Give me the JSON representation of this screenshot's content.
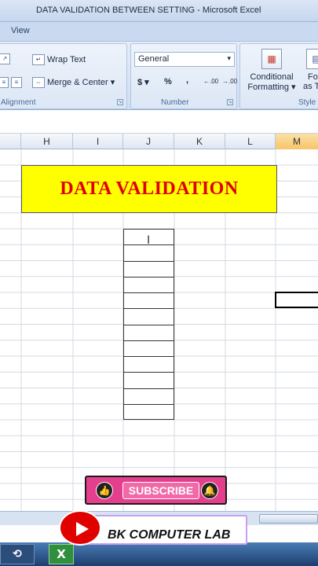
{
  "window": {
    "title": "DATA VALIDATION BETWEEN SETTING - Microsoft Excel"
  },
  "tabs": {
    "view": "View"
  },
  "ribbon": {
    "alignment": {
      "wrap_text": "Wrap Text",
      "merge_center": "Merge & Center",
      "label": "Alignment"
    },
    "number": {
      "format_value": "General",
      "currency": "$",
      "percent": "%",
      "comma": ",",
      "inc_decimal": ".00",
      "dec_decimal": ".00",
      "label": "Number"
    },
    "styles": {
      "conditional": "Conditional",
      "formatting": "Formatting",
      "format_as_table_1": "Fo",
      "format_as_table_2": "as T",
      "label": "Style"
    }
  },
  "columns": [
    "H",
    "I",
    "J",
    "K",
    "L",
    "M"
  ],
  "sheet": {
    "banner_text": "DATA VALIDATION",
    "table_rows": 12
  },
  "overlay": {
    "subscribe_label": "SUBSCRIBE",
    "channel_name": "BK COMPUTER LAB"
  },
  "colors": {
    "banner_fill": "#ffff00",
    "banner_text": "#e00000",
    "subscribe": "#e43f8c",
    "active_column": "#f7c46a"
  },
  "icons": [
    "wrap-text-icon",
    "merge-center-icon",
    "conditional-formatting-icon",
    "format-table-icon",
    "like-icon",
    "bell-icon",
    "youtube-play-icon",
    "excel-icon",
    "text-cursor-icon"
  ]
}
